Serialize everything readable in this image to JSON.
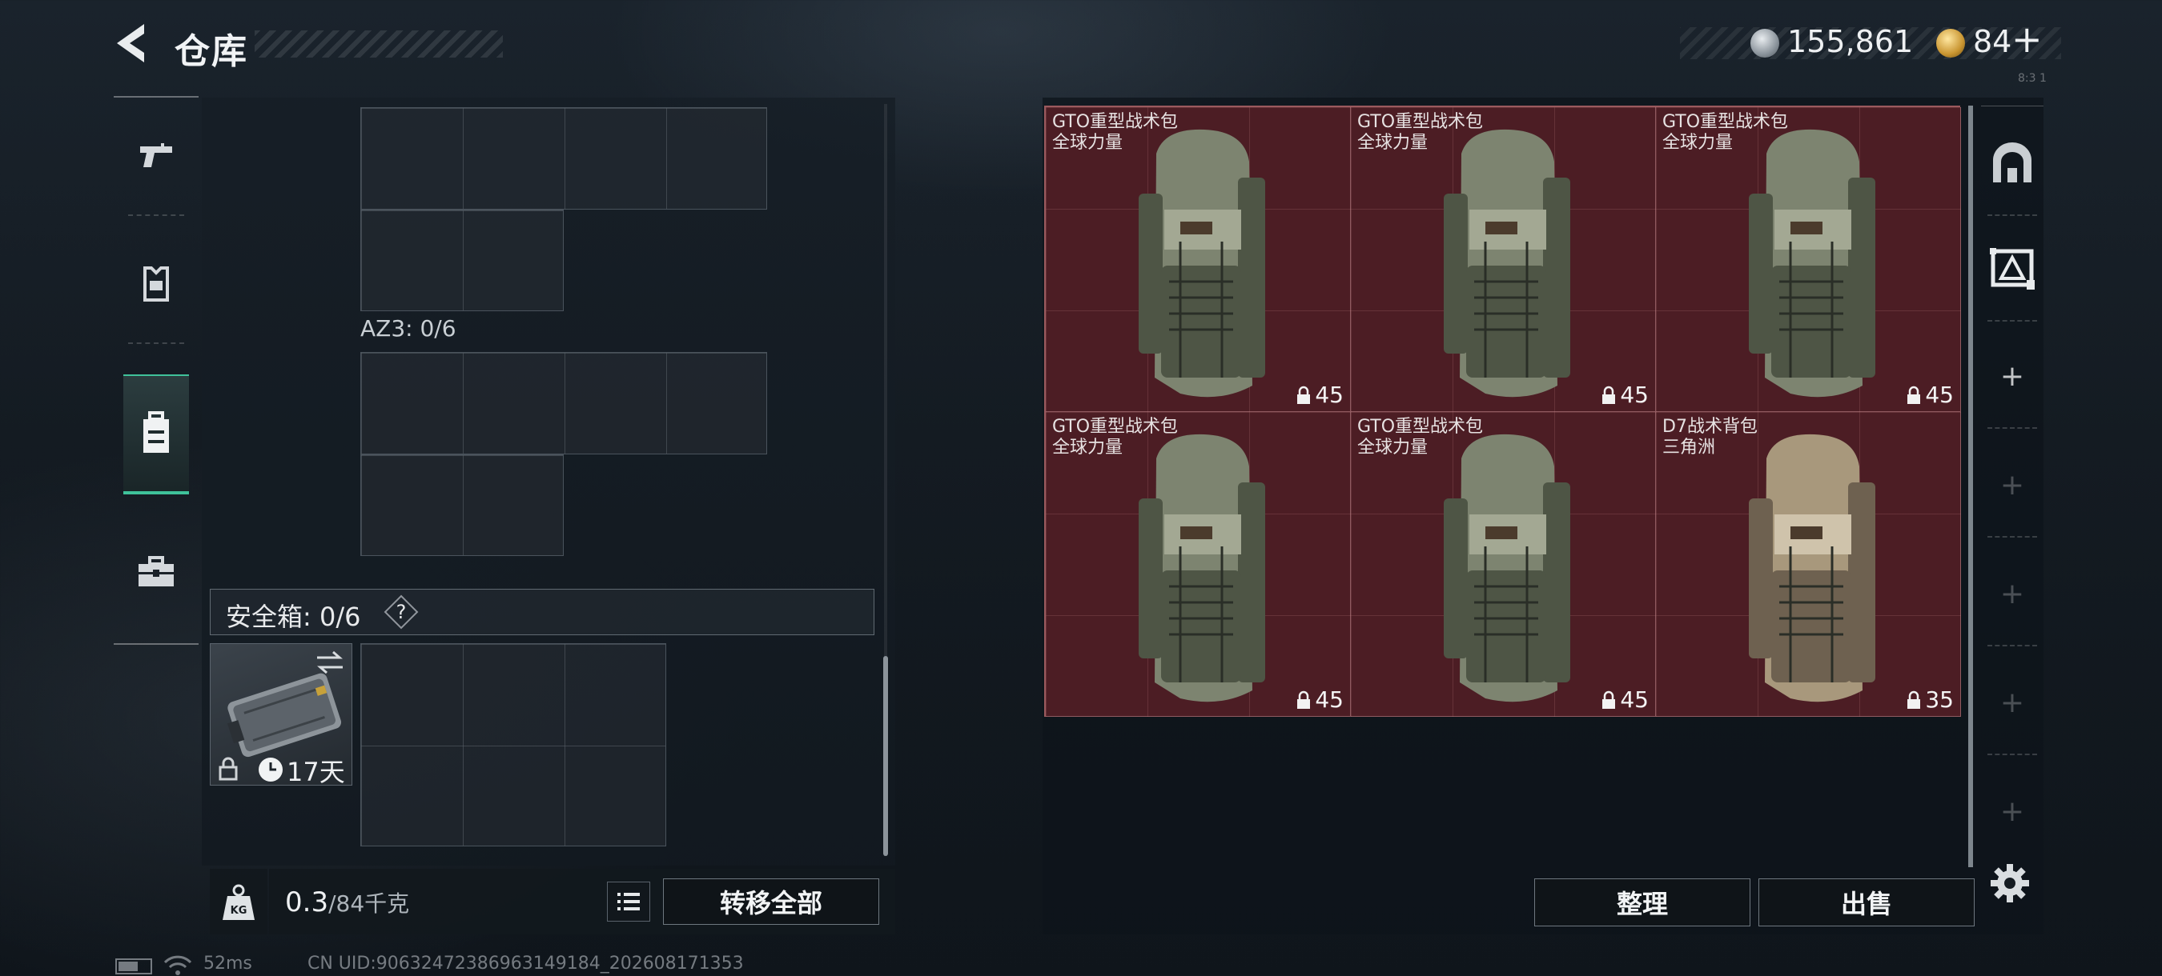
{
  "header": {
    "title": "仓库",
    "currency_silver": "155,861",
    "currency_gold": "84",
    "add_label": "+",
    "corner_code": "8:3 1"
  },
  "categories": [
    {
      "icon": "pistol-icon"
    },
    {
      "icon": "armor-icon"
    },
    {
      "icon": "backpack-icon",
      "active": true
    },
    {
      "icon": "toolbox-icon"
    }
  ],
  "container": {
    "az3_label": "AZ3: 0/6",
    "safe_label": "安全箱: 0/6",
    "help_label": "?",
    "safebox_time": "17天"
  },
  "bottom_left": {
    "weight_current": "0.3",
    "weight_max": "/84千克",
    "transfer_all": "转移全部"
  },
  "stash_items": [
    {
      "name": "GTO重型战术包",
      "source": "全球力量",
      "capacity": "45",
      "color": "green"
    },
    {
      "name": "GTO重型战术包",
      "source": "全球力量",
      "capacity": "45",
      "color": "green"
    },
    {
      "name": "GTO重型战术包",
      "source": "全球力量",
      "capacity": "45",
      "color": "green"
    },
    {
      "name": "GTO重型战术包",
      "source": "全球力量",
      "capacity": "45",
      "color": "green"
    },
    {
      "name": "GTO重型战术包",
      "source": "全球力量",
      "capacity": "45",
      "color": "green"
    },
    {
      "name": "D7战术背包",
      "source": "三角洲",
      "capacity": "35",
      "color": "tan"
    }
  ],
  "stash_actions": {
    "sort": "整理",
    "sell": "出售"
  },
  "status_bar": {
    "ping": "52ms",
    "uid": "CN UID:9063247238696314​9184_202608171353"
  },
  "colors": {
    "accent": "#3fc29a",
    "stash_bg": "#4c1d24"
  }
}
